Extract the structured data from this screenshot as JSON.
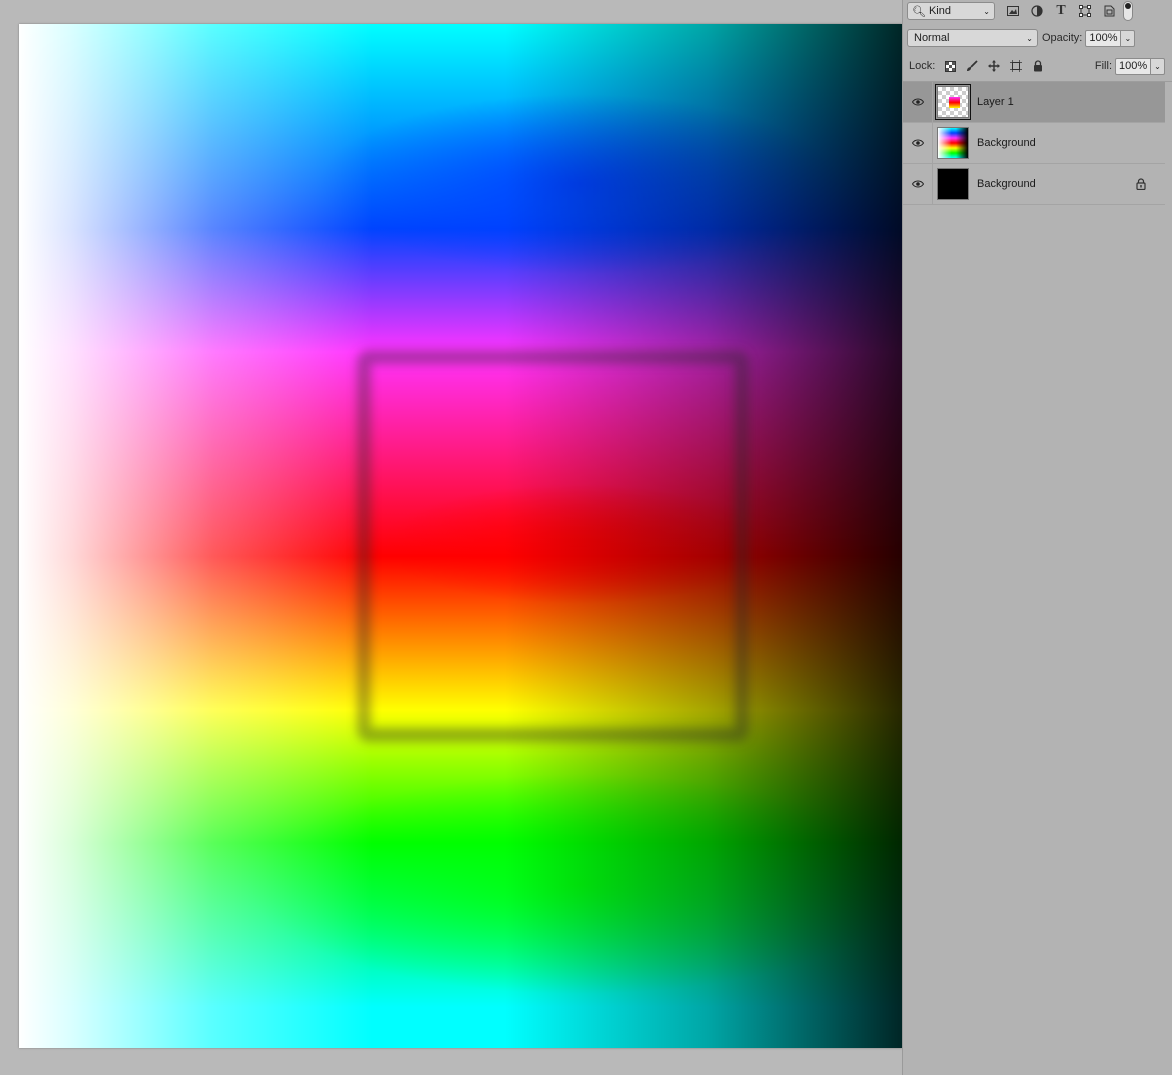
{
  "filter": {
    "kind_label": "Kind",
    "icons": [
      "image-filter-icon",
      "adjustment-filter-icon",
      "type-filter-icon",
      "shape-filter-icon",
      "smart-object-filter-icon"
    ]
  },
  "blend": {
    "mode": "Normal",
    "opacity_label": "Opacity:",
    "opacity_value": "100%"
  },
  "lock": {
    "label": "Lock:",
    "fill_label": "Fill:",
    "fill_value": "100%"
  },
  "layers": [
    {
      "name": "Layer 1",
      "visible": true,
      "selected": true,
      "locked": false
    },
    {
      "name": "Background",
      "visible": true,
      "selected": false,
      "locked": false
    },
    {
      "name": "Background",
      "visible": true,
      "selected": false,
      "locked": true
    }
  ],
  "colors": {
    "panel_bg": "#b3b3b3",
    "selected_layer_bg": "#979797",
    "workspace_bg": "#b9b9b9"
  }
}
